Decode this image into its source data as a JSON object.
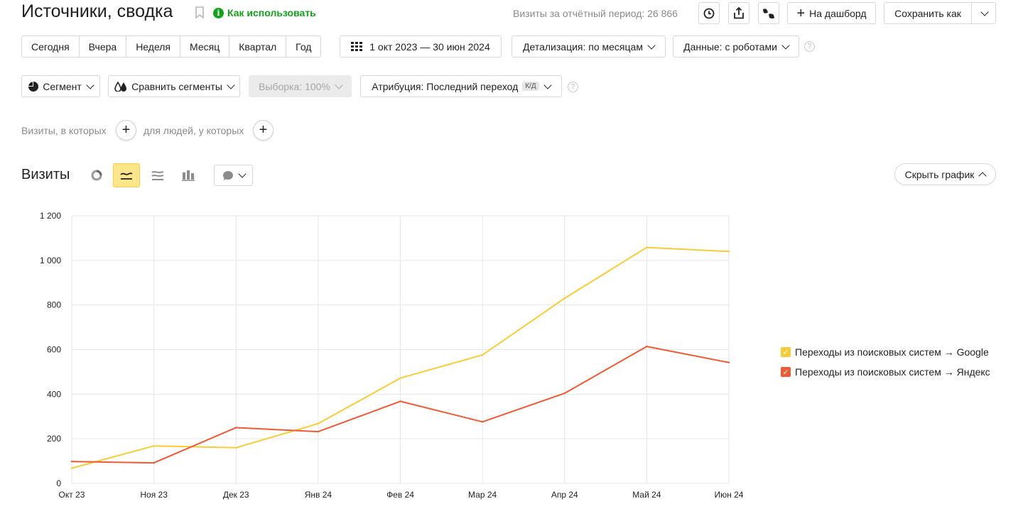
{
  "header": {
    "title": "Источники, сводка",
    "howto_label": "Как использовать",
    "period_visits": "Визиты за отчётный период: 26 866",
    "dashboard_label": "На дашборд",
    "save_as_label": "Сохранить как"
  },
  "periods": [
    "Сегодня",
    "Вчера",
    "Неделя",
    "Месяц",
    "Квартал",
    "Год"
  ],
  "date_range": "1 окт 2023 — 30 июн 2024",
  "detail_label": "Детализация: по месяцам",
  "data_label": "Данные: с роботами",
  "segment_label": "Сегмент",
  "compare_label": "Сравнить сегменты",
  "sample_label": "Выборка: 100%",
  "attribution_label": "Атрибуция: Последний переход",
  "attribution_badge": "К/Д",
  "filters": {
    "visits_where": "Визиты, в которых",
    "people_where": "для людей, у которых"
  },
  "chart_section": {
    "title": "Визиты",
    "hide_label": "Скрыть график"
  },
  "colors": {
    "google": "#f7cc3b",
    "yandex": "#ee5a35",
    "accent_active": "#fde58a"
  },
  "chart_data": {
    "type": "line",
    "categories": [
      "Окт 23",
      "Ноя 23",
      "Дек 23",
      "Янв 24",
      "Фев 24",
      "Мар 24",
      "Апр 24",
      "Май 24",
      "Июн 24"
    ],
    "ylim": [
      0,
      1200
    ],
    "yticks": [
      0,
      200,
      400,
      600,
      800,
      1000,
      1200
    ],
    "ytick_labels": [
      "0",
      "200",
      "400",
      "600",
      "800",
      "1 000",
      "1 200"
    ],
    "grid": true,
    "legend_position": "right",
    "series": [
      {
        "name": "Переходы из поисковых систем → Google",
        "color": "#f7cc3b",
        "values": [
          68,
          168,
          160,
          268,
          472,
          576,
          830,
          1058,
          1040
        ]
      },
      {
        "name": "Переходы из поисковых систем → Яндекс",
        "color": "#ee5a35",
        "values": [
          98,
          92,
          250,
          232,
          368,
          276,
          404,
          614,
          542
        ]
      }
    ]
  }
}
